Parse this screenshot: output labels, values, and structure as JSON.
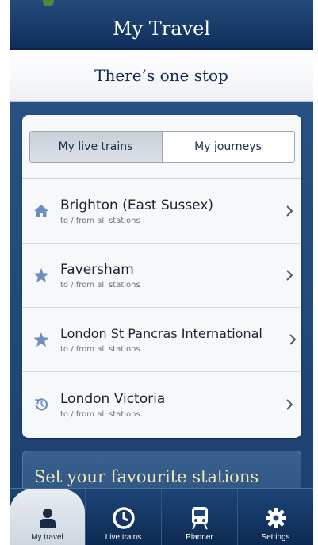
{
  "header": {
    "title": "My Travel"
  },
  "banner": {
    "text": "There’s one stop"
  },
  "segments": {
    "live": "My live trains",
    "journeys": "My journeys"
  },
  "stations": [
    {
      "name": "Brighton (East Sussex)",
      "detail": "to / from all stations",
      "icon": "home-icon"
    },
    {
      "name": "Faversham",
      "detail": "to / from all stations",
      "icon": "star-icon"
    },
    {
      "name": "London St Pancras International",
      "detail": "to / from all stations",
      "icon": "star-icon"
    },
    {
      "name": "London Victoria",
      "detail": "to / from all stations",
      "icon": "history-icon"
    }
  ],
  "promo": {
    "text": "Set your favourite stations"
  },
  "tabs": [
    {
      "label": "My travel",
      "icon": "person-icon",
      "active": true
    },
    {
      "label": "Live trains",
      "icon": "clock-icon",
      "active": false
    },
    {
      "label": "Planner",
      "icon": "train-icon",
      "active": false
    },
    {
      "label": "Settings",
      "icon": "gear-icon",
      "active": false
    }
  ],
  "colors": {
    "navy": "#1c3f6d",
    "promo_text": "#f2e9b2",
    "icon_blue": "#6b8fc0"
  }
}
